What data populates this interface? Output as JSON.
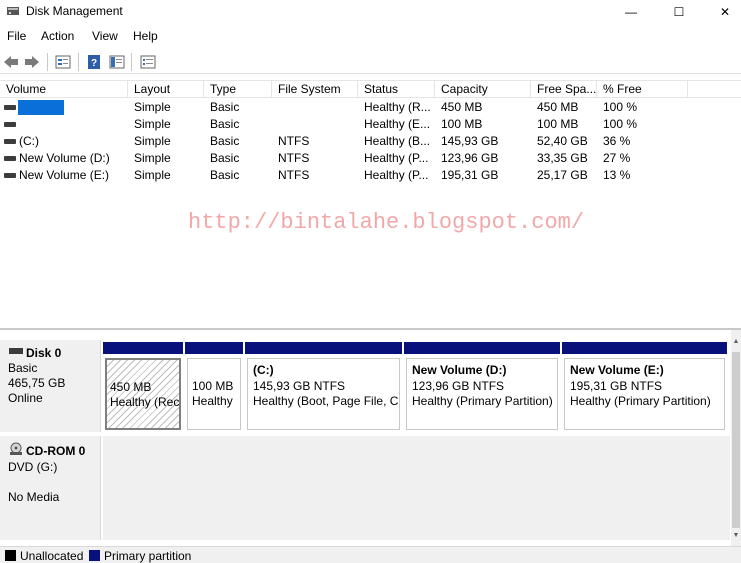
{
  "window": {
    "title": "Disk Management",
    "minimize_glyph": "—",
    "maximize_glyph": "☐",
    "close_glyph": "✕"
  },
  "menu": [
    "File",
    "Action",
    "View",
    "Help"
  ],
  "toolbar_icons": [
    "back-arrow-icon",
    "forward-arrow-icon",
    "properties-icon",
    "help-icon",
    "console-tree-icon",
    "list-view-icon"
  ],
  "columns": [
    "Volume",
    "Layout",
    "Type",
    "File System",
    "Status",
    "Capacity",
    "Free Spa...",
    "% Free"
  ],
  "volumes": [
    {
      "name": "",
      "layout": "Simple",
      "type": "Basic",
      "fs": "",
      "status": "Healthy (R...",
      "capacity": "450 MB",
      "free": "450 MB",
      "pct": "100 %",
      "selected": true
    },
    {
      "name": "",
      "layout": "Simple",
      "type": "Basic",
      "fs": "",
      "status": "Healthy (E...",
      "capacity": "100 MB",
      "free": "100 MB",
      "pct": "100 %"
    },
    {
      "name": "(C:)",
      "layout": "Simple",
      "type": "Basic",
      "fs": "NTFS",
      "status": "Healthy (B...",
      "capacity": "145,93 GB",
      "free": "52,40 GB",
      "pct": "36 %"
    },
    {
      "name": "New Volume (D:)",
      "layout": "Simple",
      "type": "Basic",
      "fs": "NTFS",
      "status": "Healthy (P...",
      "capacity": "123,96 GB",
      "free": "33,35 GB",
      "pct": "27 %"
    },
    {
      "name": "New Volume (E:)",
      "layout": "Simple",
      "type": "Basic",
      "fs": "NTFS",
      "status": "Healthy (P...",
      "capacity": "195,31 GB",
      "free": "25,17 GB",
      "pct": "13 %"
    }
  ],
  "watermark": "http://bintalahe.blogspot.com/",
  "disk0": {
    "name": "Disk 0",
    "type": "Basic",
    "size": "465,75 GB",
    "state": "Online",
    "partitions": [
      {
        "title": "",
        "line1": "450 MB",
        "line2": "Healthy (Rec",
        "hatched": true
      },
      {
        "title": "",
        "line1": "100 MB",
        "line2": "Healthy"
      },
      {
        "title": "(C:)",
        "line1": "145,93 GB NTFS",
        "line2": "Healthy (Boot, Page File, Cr"
      },
      {
        "title": "New Volume  (D:)",
        "line1": "123,96 GB NTFS",
        "line2": "Healthy (Primary Partition)"
      },
      {
        "title": "New Volume  (E:)",
        "line1": "195,31 GB NTFS",
        "line2": "Healthy (Primary Partition)"
      }
    ]
  },
  "cdrom0": {
    "name": "CD-ROM 0",
    "drive": "DVD (G:)",
    "media": "No Media"
  },
  "legend": [
    {
      "label": "Unallocated",
      "color": "#000000"
    },
    {
      "label": "Primary partition",
      "color": "#08107c"
    }
  ]
}
